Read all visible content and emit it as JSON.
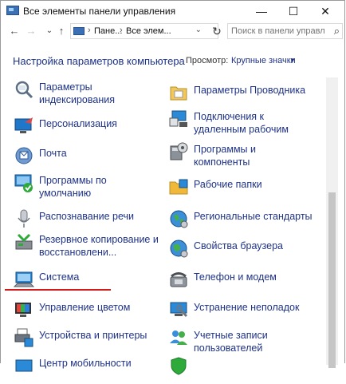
{
  "window": {
    "title": "Все элементы панели управления",
    "minimize": "—",
    "maximize": "☐",
    "close": "✕"
  },
  "nav": {
    "back": "←",
    "forward": "→",
    "recent": "⌄",
    "up": "↑",
    "breadcrumb": [
      "Пане...",
      "Все элем..."
    ],
    "search_placeholder": "Поиск в панели управле..."
  },
  "header": {
    "title": "Настройка параметров компьютера",
    "view_label": "Просмотр:",
    "view_value": "Крупные значки"
  },
  "items_left": [
    {
      "label": "Параметры\nиндексирования",
      "icon": "indexing-icon"
    },
    {
      "label": "Персонализация",
      "icon": "personalization-icon"
    },
    {
      "label": "Почта",
      "icon": "mail-icon"
    },
    {
      "label": "Программы по\nумолчанию",
      "icon": "default-programs-icon"
    },
    {
      "label": "Распознавание речи",
      "icon": "microphone-icon"
    },
    {
      "label": "Резервное копирование и\nвосстановлени...",
      "icon": "backup-icon"
    },
    {
      "label": "Система",
      "icon": "system-icon"
    },
    {
      "label": "Управление цветом",
      "icon": "color-management-icon"
    },
    {
      "label": "Устройства и принтеры",
      "icon": "printer-icon"
    },
    {
      "label": "Центр мобильности",
      "icon": "mobility-center-icon"
    }
  ],
  "items_right": [
    {
      "label": "Параметры Проводника",
      "icon": "folder-options-icon"
    },
    {
      "label": "Подключения к\nудаленным рабочим",
      "icon": "remote-connections-icon"
    },
    {
      "label": "Программы и\nкомпоненты",
      "icon": "programs-features-icon"
    },
    {
      "label": "Рабочие папки",
      "icon": "work-folders-icon"
    },
    {
      "label": "Региональные стандарты",
      "icon": "region-icon"
    },
    {
      "label": "Свойства браузера",
      "icon": "internet-options-icon"
    },
    {
      "label": "Телефон и модем",
      "icon": "phone-modem-icon"
    },
    {
      "label": "Устранение неполадок",
      "icon": "troubleshooting-icon"
    },
    {
      "label": "Учетные записи\nпользователей",
      "icon": "user-accounts-icon"
    },
    {
      "label": "",
      "icon": "windows-defender-icon"
    }
  ],
  "colors": {
    "link": "#1e3287",
    "highlight_underline": "#d11a1a"
  }
}
